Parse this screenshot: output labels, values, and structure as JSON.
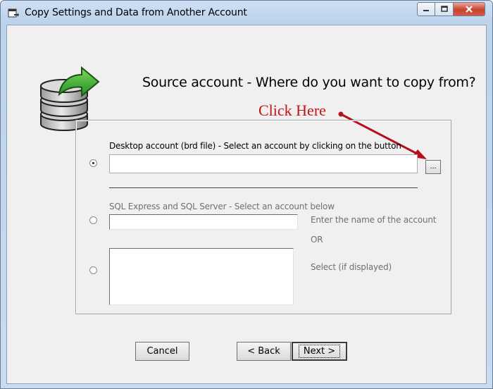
{
  "window": {
    "title": "Copy Settings and Data from Another Account"
  },
  "header": {
    "heading": "Source account - Where do you want to copy from?"
  },
  "annotation": {
    "text": "Click Here",
    "color": "#c0141a"
  },
  "desktop_option": {
    "label": "Desktop account (brd file) - Select an account by clicking on the button",
    "selected": true,
    "path_value": "",
    "browse_label": "..."
  },
  "sql_section": {
    "label": "SQL Express and SQL Server - Select an account below",
    "name_option": {
      "selected": false,
      "value": "",
      "hint": "Enter the name of the account"
    },
    "or_text": "OR",
    "list_option": {
      "selected": false,
      "hint": "Select (if displayed)",
      "items": []
    }
  },
  "buttons": {
    "cancel": "Cancel",
    "back": "< Back",
    "next": "Next >"
  },
  "icons": {
    "app": "copy-window-icon",
    "database": "database-copy-icon",
    "minimize": "minimize-icon",
    "maximize": "maximize-icon",
    "close": "close-icon"
  }
}
